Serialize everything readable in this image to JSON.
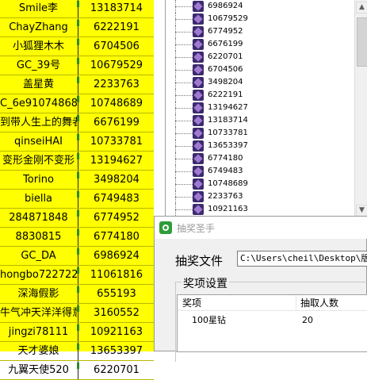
{
  "spreadsheet": {
    "rows": [
      {
        "name": "Smile李",
        "id": "13183714"
      },
      {
        "name": "ChayZhang",
        "id": "6222191"
      },
      {
        "name": "小狐狸木木",
        "id": "6704506"
      },
      {
        "name": "GC_39号",
        "id": "10679529"
      },
      {
        "name": "盖星黄",
        "id": "2233763"
      },
      {
        "name": "C_6e91074868",
        "id": "10748689"
      },
      {
        "name": "到带人生上的舞者",
        "id": "6676199"
      },
      {
        "name": "qinseiHAI",
        "id": "10733781"
      },
      {
        "name": "变形金刚不变形",
        "id": "13194627"
      },
      {
        "name": "Torino",
        "id": "3498204"
      },
      {
        "name": "biella",
        "id": "6749483"
      },
      {
        "name": "284871848",
        "id": "6774952"
      },
      {
        "name": "8830815",
        "id": "6774180"
      },
      {
        "name": "GC_DA",
        "id": "6986924"
      },
      {
        "name": "hongbo722722",
        "id": "11061816"
      },
      {
        "name": "深海假影",
        "id": "655193"
      },
      {
        "name": "牛气冲天洋洋得意",
        "id": "3160552"
      },
      {
        "name": "jingzi78111",
        "id": "10921163"
      },
      {
        "name": "天才婆娘",
        "id": "13653397"
      },
      {
        "name": "九翼天使520",
        "id": "6220701"
      }
    ]
  },
  "tree_list": {
    "items": [
      "6986924",
      "10679529",
      "6774952",
      "6676199",
      "6220701",
      "6704506",
      "3498204",
      "6222191",
      "13194627",
      "13183714",
      "10733781",
      "13653397",
      "6774180",
      "6749483",
      "10748689",
      "2233763",
      "10921163"
    ],
    "scroll_up_icon": "triangle-up-icon",
    "scroll_down_icon": "triangle-down-icon"
  },
  "dialog": {
    "title": "抽奖圣手",
    "file_label": "抽奖文件",
    "file_path": "C:\\Users\\cheil\\Desktop\\版块",
    "prize_group_label": "奖项设置",
    "columns": [
      "奖项",
      "抽取人数"
    ],
    "prizes": [
      {
        "name": "100星钻",
        "count": "20"
      }
    ]
  }
}
